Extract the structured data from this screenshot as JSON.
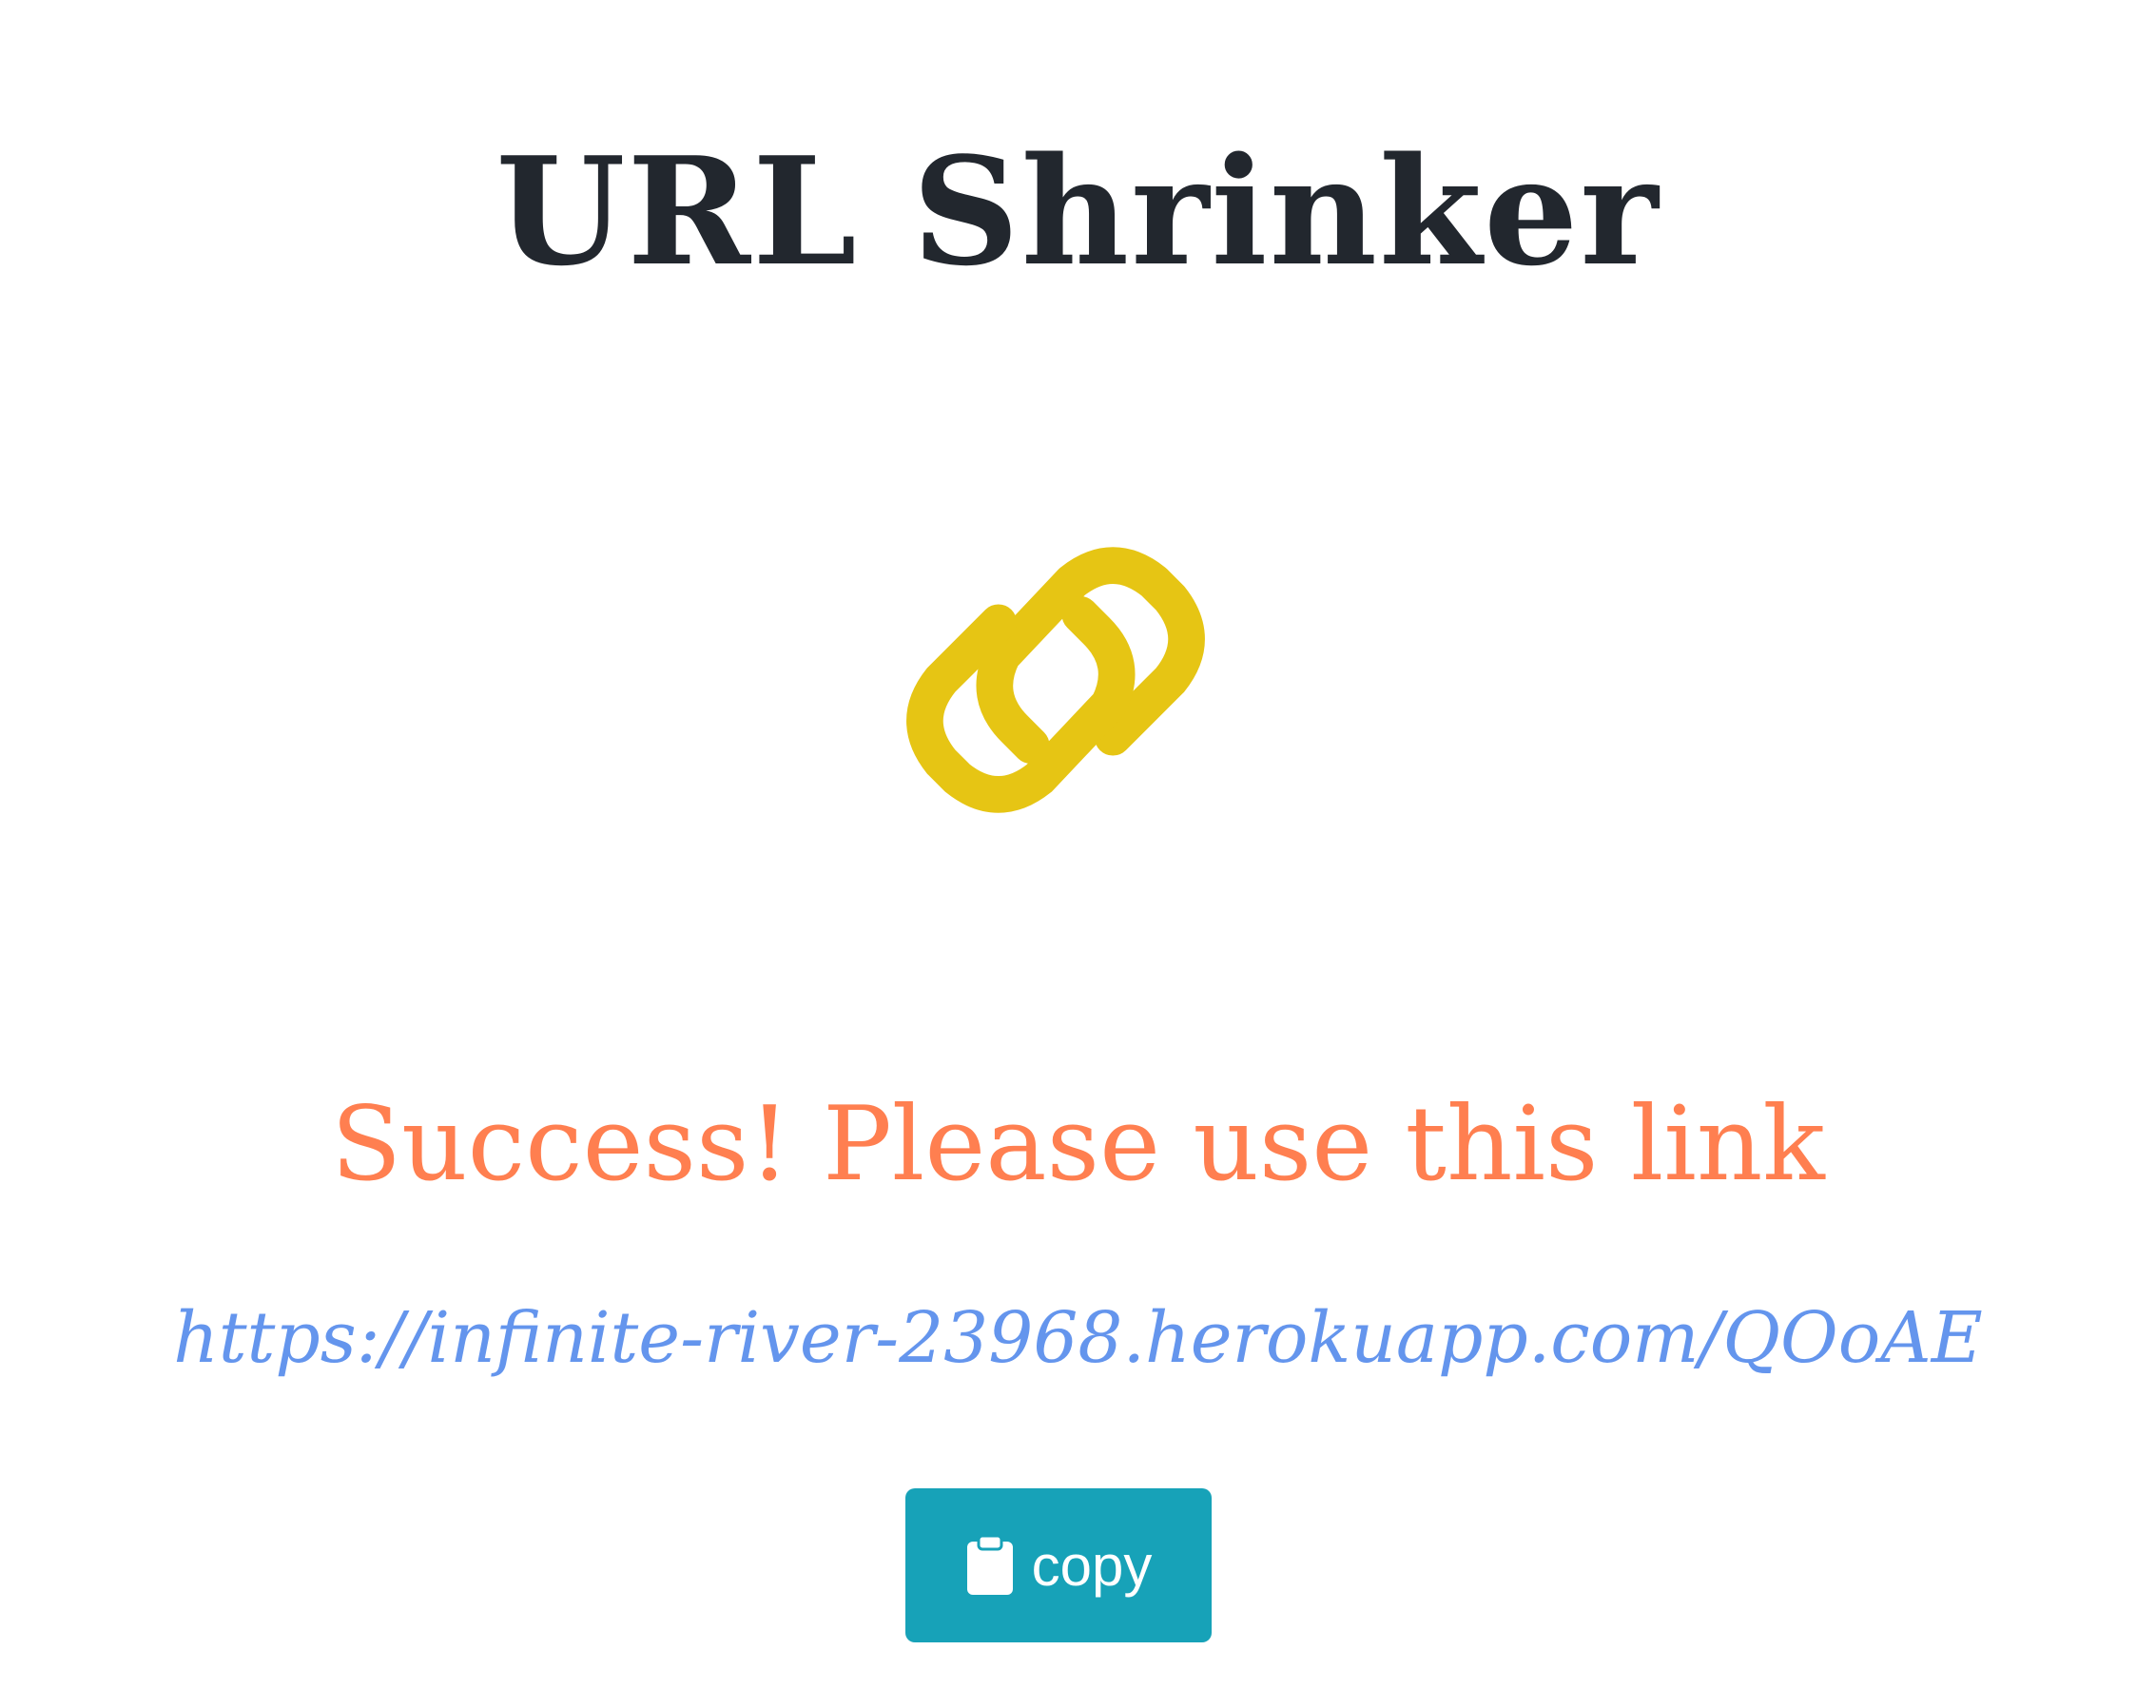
{
  "header": {
    "title": "URL Shrinker"
  },
  "logo": {
    "icon": "link-icon",
    "color": "#e6c514"
  },
  "result": {
    "message": "Success! Please use this link",
    "message_color": "#ff7f50",
    "short_url": "https://infinite-river-23968.herokuapp.com/QOoAE",
    "link_color": "#6495ed"
  },
  "actions": {
    "copy_label": "copy",
    "copy_icon": "clipboard-icon",
    "button_color": "#17a2b8"
  }
}
